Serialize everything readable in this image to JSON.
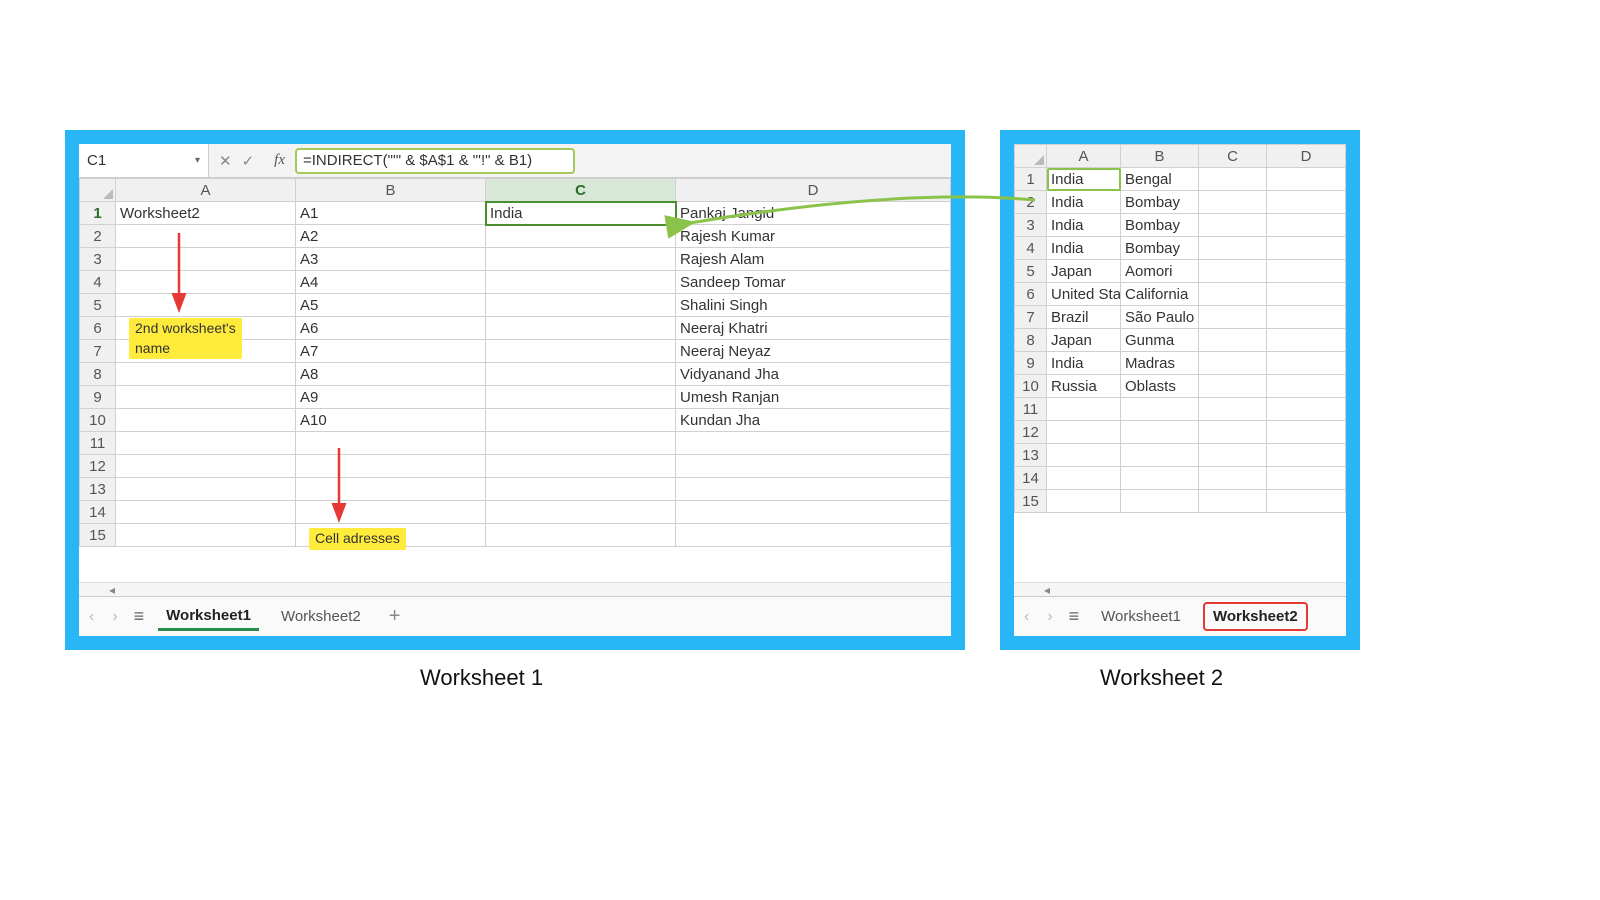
{
  "left": {
    "nameBox": "C1",
    "formula": "=INDIRECT(\"'\" & $A$1 & \"'!\" & B1)",
    "cols": [
      "A",
      "B",
      "C",
      "D"
    ],
    "rows": [
      {
        "n": 1,
        "A": "Worksheet2",
        "B": "A1",
        "C": "India",
        "D": "Pankaj Jangid"
      },
      {
        "n": 2,
        "A": "",
        "B": "A2",
        "C": "",
        "D": "Rajesh Kumar"
      },
      {
        "n": 3,
        "A": "",
        "B": "A3",
        "C": "",
        "D": "Rajesh Alam"
      },
      {
        "n": 4,
        "A": "",
        "B": "A4",
        "C": "",
        "D": "Sandeep Tomar"
      },
      {
        "n": 5,
        "A": "",
        "B": "A5",
        "C": "",
        "D": "Shalini Singh"
      },
      {
        "n": 6,
        "A": "",
        "B": "A6",
        "C": "",
        "D": "Neeraj Khatri"
      },
      {
        "n": 7,
        "A": "",
        "B": "A7",
        "C": "",
        "D": "Neeraj Neyaz"
      },
      {
        "n": 8,
        "A": "",
        "B": "A8",
        "C": "",
        "D": "Vidyanand Jha"
      },
      {
        "n": 9,
        "A": "",
        "B": "A9",
        "C": "",
        "D": "Umesh Ranjan"
      },
      {
        "n": 10,
        "A": "",
        "B": "A10",
        "C": "",
        "D": "Kundan Jha"
      },
      {
        "n": 11,
        "A": "",
        "B": "",
        "C": "",
        "D": ""
      },
      {
        "n": 12,
        "A": "",
        "B": "",
        "C": "",
        "D": ""
      },
      {
        "n": 13,
        "A": "",
        "B": "",
        "C": "",
        "D": ""
      },
      {
        "n": 14,
        "A": "",
        "B": "",
        "C": "",
        "D": ""
      },
      {
        "n": 15,
        "A": "",
        "B": "",
        "C": "",
        "D": ""
      }
    ],
    "tabs": {
      "t1": "Worksheet1",
      "t2": "Worksheet2"
    },
    "annot": {
      "wsname": "2nd worksheet's\nname",
      "celladdr": "Cell adresses"
    },
    "caption": "Worksheet 1"
  },
  "right": {
    "cols": [
      "A",
      "B",
      "C",
      "D"
    ],
    "rows": [
      {
        "n": 1,
        "A": "India",
        "B": "Bengal"
      },
      {
        "n": 2,
        "A": "India",
        "B": "Bombay"
      },
      {
        "n": 3,
        "A": "India",
        "B": "Bombay"
      },
      {
        "n": 4,
        "A": "India",
        "B": "Bombay"
      },
      {
        "n": 5,
        "A": "Japan",
        "B": "Aomori"
      },
      {
        "n": 6,
        "A": "United Sta",
        "B": "California"
      },
      {
        "n": 7,
        "A": "Brazil",
        "B": "São Paulo"
      },
      {
        "n": 8,
        "A": "Japan",
        "B": "Gunma"
      },
      {
        "n": 9,
        "A": "India",
        "B": "Madras"
      },
      {
        "n": 10,
        "A": "Russia",
        "B": "Oblasts"
      },
      {
        "n": 11,
        "A": "",
        "B": ""
      },
      {
        "n": 12,
        "A": "",
        "B": ""
      },
      {
        "n": 13,
        "A": "",
        "B": ""
      },
      {
        "n": 14,
        "A": "",
        "B": ""
      },
      {
        "n": 15,
        "A": "",
        "B": ""
      }
    ],
    "tabs": {
      "t1": "Worksheet1",
      "t2": "Worksheet2"
    },
    "caption": "Worksheet 2"
  }
}
